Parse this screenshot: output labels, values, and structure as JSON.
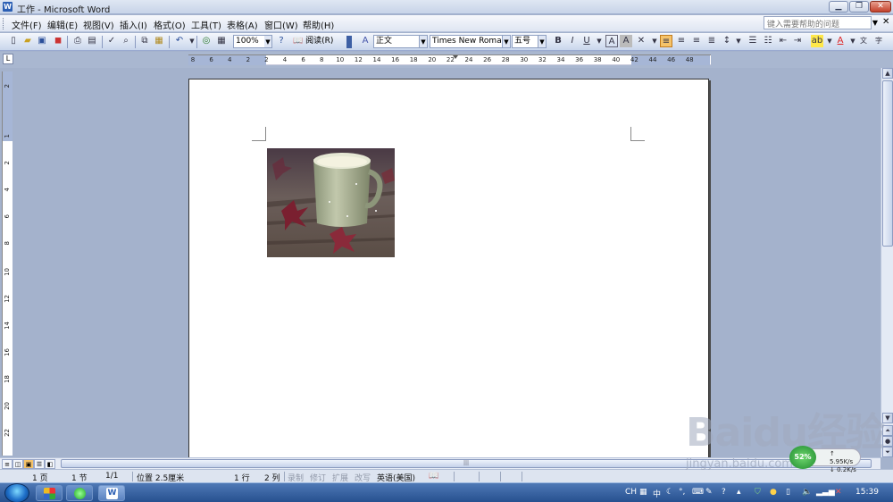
{
  "window": {
    "title": "工作 - Microsoft Word",
    "app_icon": "W"
  },
  "menu": {
    "items": [
      "文件(F)",
      "编辑(E)",
      "视图(V)",
      "插入(I)",
      "格式(O)",
      "工具(T)",
      "表格(A)",
      "窗口(W)",
      "帮助(H)"
    ],
    "help_placeholder": "键入需要帮助的问题"
  },
  "toolbar": {
    "zoom": "100%",
    "read_label": "阅读(R)",
    "style": "正文",
    "font": "Times New Roman",
    "size": "五号"
  },
  "ruler": {
    "h_ticks": [
      "8",
      "6",
      "4",
      "2",
      "2",
      "4",
      "6",
      "8",
      "10",
      "12",
      "14",
      "16",
      "18",
      "20",
      "22",
      "24",
      "26",
      "28",
      "30",
      "32",
      "34",
      "36",
      "38",
      "40",
      "42",
      "44",
      "46",
      "48"
    ],
    "v_ticks": [
      "2",
      "1",
      "2",
      "4",
      "6",
      "8",
      "10",
      "12",
      "14",
      "16",
      "18",
      "20",
      "22"
    ]
  },
  "document": {
    "image_alt": "马克杯与落叶"
  },
  "status": {
    "page": "1 页",
    "section": "1 节",
    "page_of": "1/1",
    "position": "位置 2.5厘米",
    "line": "1 行",
    "column": "2 列",
    "rec": "录制",
    "trk": "修订",
    "ext": "扩展",
    "ovr": "改写",
    "language": "英语(美国)"
  },
  "taskbar": {
    "lang": "CH",
    "ime": "中",
    "clock": "15:39"
  },
  "net_widget": {
    "percent": "52%",
    "up": "5.95K/s",
    "down": "0.2K/s"
  },
  "watermark": {
    "logo": "Baidu经验",
    "url": "jingyan.baidu.com"
  }
}
